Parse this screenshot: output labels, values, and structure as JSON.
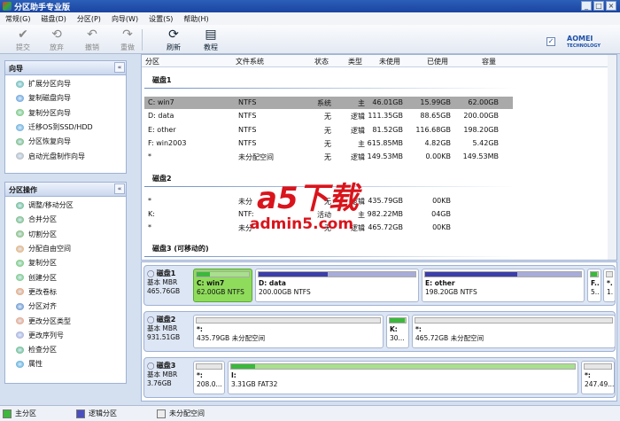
{
  "window": {
    "title": "分区助手专业版",
    "min": "_",
    "max": "□",
    "close": "×"
  },
  "menu": [
    "常规(G)",
    "磁盘(D)",
    "分区(P)",
    "向导(W)",
    "设置(S)",
    "帮助(H)"
  ],
  "toolbar": [
    {
      "label": "提交",
      "icon": "✔",
      "enabled": false
    },
    {
      "label": "放弃",
      "icon": "⟲",
      "enabled": false
    },
    {
      "label": "撤销",
      "icon": "↶",
      "enabled": false
    },
    {
      "label": "重做",
      "icon": "↷",
      "enabled": false
    },
    {
      "label": "刷新",
      "icon": "⟳",
      "enabled": true
    },
    {
      "label": "教程",
      "icon": "▤",
      "enabled": true
    }
  ],
  "brand": {
    "name": "AOMEI",
    "sub": "TECHNOLOGY",
    "check": "✓"
  },
  "wizard": {
    "title": "向导",
    "collapse": "«",
    "items": [
      "扩展分区向导",
      "复制磁盘向导",
      "复制分区向导",
      "迁移OS到SSD/HDD",
      "分区恢复向导",
      "启动光盘制作向导"
    ]
  },
  "ops": {
    "title": "分区操作",
    "collapse": "«",
    "items": [
      "调整/移动分区",
      "合并分区",
      "切割分区",
      "分配自由空间",
      "复制分区",
      "创建分区",
      "更改卷标",
      "分区对齐",
      "更改分区类型",
      "更改序列号",
      "检查分区",
      "属性"
    ]
  },
  "columns": [
    "分区",
    "文件系统",
    "容量",
    "已使用",
    "未使用",
    "类型",
    "状态"
  ],
  "groups": [
    {
      "name": "磁盘1",
      "rows": [
        [
          "C: win7",
          "NTFS",
          "62.00GB",
          "15.99GB",
          "46.01GB",
          "主",
          "系统"
        ],
        [
          "D: data",
          "NTFS",
          "200.00GB",
          "88.65GB",
          "111.35GB",
          "逻辑",
          "无"
        ],
        [
          "E: other",
          "NTFS",
          "198.20GB",
          "116.68GB",
          "81.52GB",
          "逻辑",
          "无"
        ],
        [
          "F: win2003",
          "NTFS",
          "5.42GB",
          "4.82GB",
          "615.85MB",
          "主",
          "无"
        ],
        [
          "*",
          "未分配空间",
          "149.53MB",
          "0.00KB",
          "149.53MB",
          "逻辑",
          "无"
        ]
      ]
    },
    {
      "name": "磁盘2",
      "rows": [
        [
          "*",
          "未分",
          "",
          "00KB",
          "435.79GB",
          "逻辑",
          "无"
        ],
        [
          "K:",
          "NTF:",
          "",
          "04GB",
          "982.22MB",
          "主",
          "活动"
        ],
        [
          "*",
          "未分",
          "",
          "00KB",
          "465.72GB",
          "逻辑",
          "无"
        ]
      ]
    },
    {
      "name": "磁盘3 (可移动的)",
      "rows": []
    }
  ],
  "watermark": {
    "brand": "a5下载",
    "url": "admin5.com"
  },
  "disks": [
    {
      "name": "磁盘1",
      "type": "基本 MBR",
      "size": "465.76GB",
      "parts": [
        {
          "n": "C: win7",
          "d": "62.00GB NTFS",
          "kind": "primary",
          "used": 0.26,
          "sel": true
        },
        {
          "n": "D: data",
          "d": "200.00GB NTFS",
          "kind": "logical",
          "used": 0.44
        },
        {
          "n": "E: other",
          "d": "198.20GB NTFS",
          "kind": "logical",
          "used": 0.59
        },
        {
          "n": "F..",
          "d": "5..",
          "kind": "primary",
          "used": 0.89
        },
        {
          "n": "*.",
          "d": "1.",
          "kind": "unalloc",
          "used": 0
        }
      ]
    },
    {
      "name": "磁盘2",
      "type": "基本 MBR",
      "size": "931.51GB",
      "parts": [
        {
          "n": "*:",
          "d": "435.79GB 未分配空间",
          "kind": "unalloc",
          "used": 0
        },
        {
          "n": "K:",
          "d": "30...",
          "kind": "primary",
          "used": 0.97
        },
        {
          "n": "*:",
          "d": "465.72GB 未分配空间",
          "kind": "unalloc",
          "used": 0
        }
      ]
    },
    {
      "name": "磁盘3",
      "type": "基本 MBR",
      "size": "3.76GB",
      "parts": [
        {
          "n": "*:",
          "d": "208.0...",
          "kind": "unalloc",
          "used": 0
        },
        {
          "n": "I:",
          "d": "3.31GB FAT32",
          "kind": "primary",
          "used": 0.07
        },
        {
          "n": "*:",
          "d": "247.49...",
          "kind": "unalloc",
          "used": 0
        }
      ]
    }
  ],
  "legend": [
    {
      "label": "主分区",
      "color": "#3cb83c"
    },
    {
      "label": "逻辑分区",
      "color": "#4a4fc0"
    },
    {
      "label": "未分配空间",
      "color": "#ececec"
    }
  ]
}
